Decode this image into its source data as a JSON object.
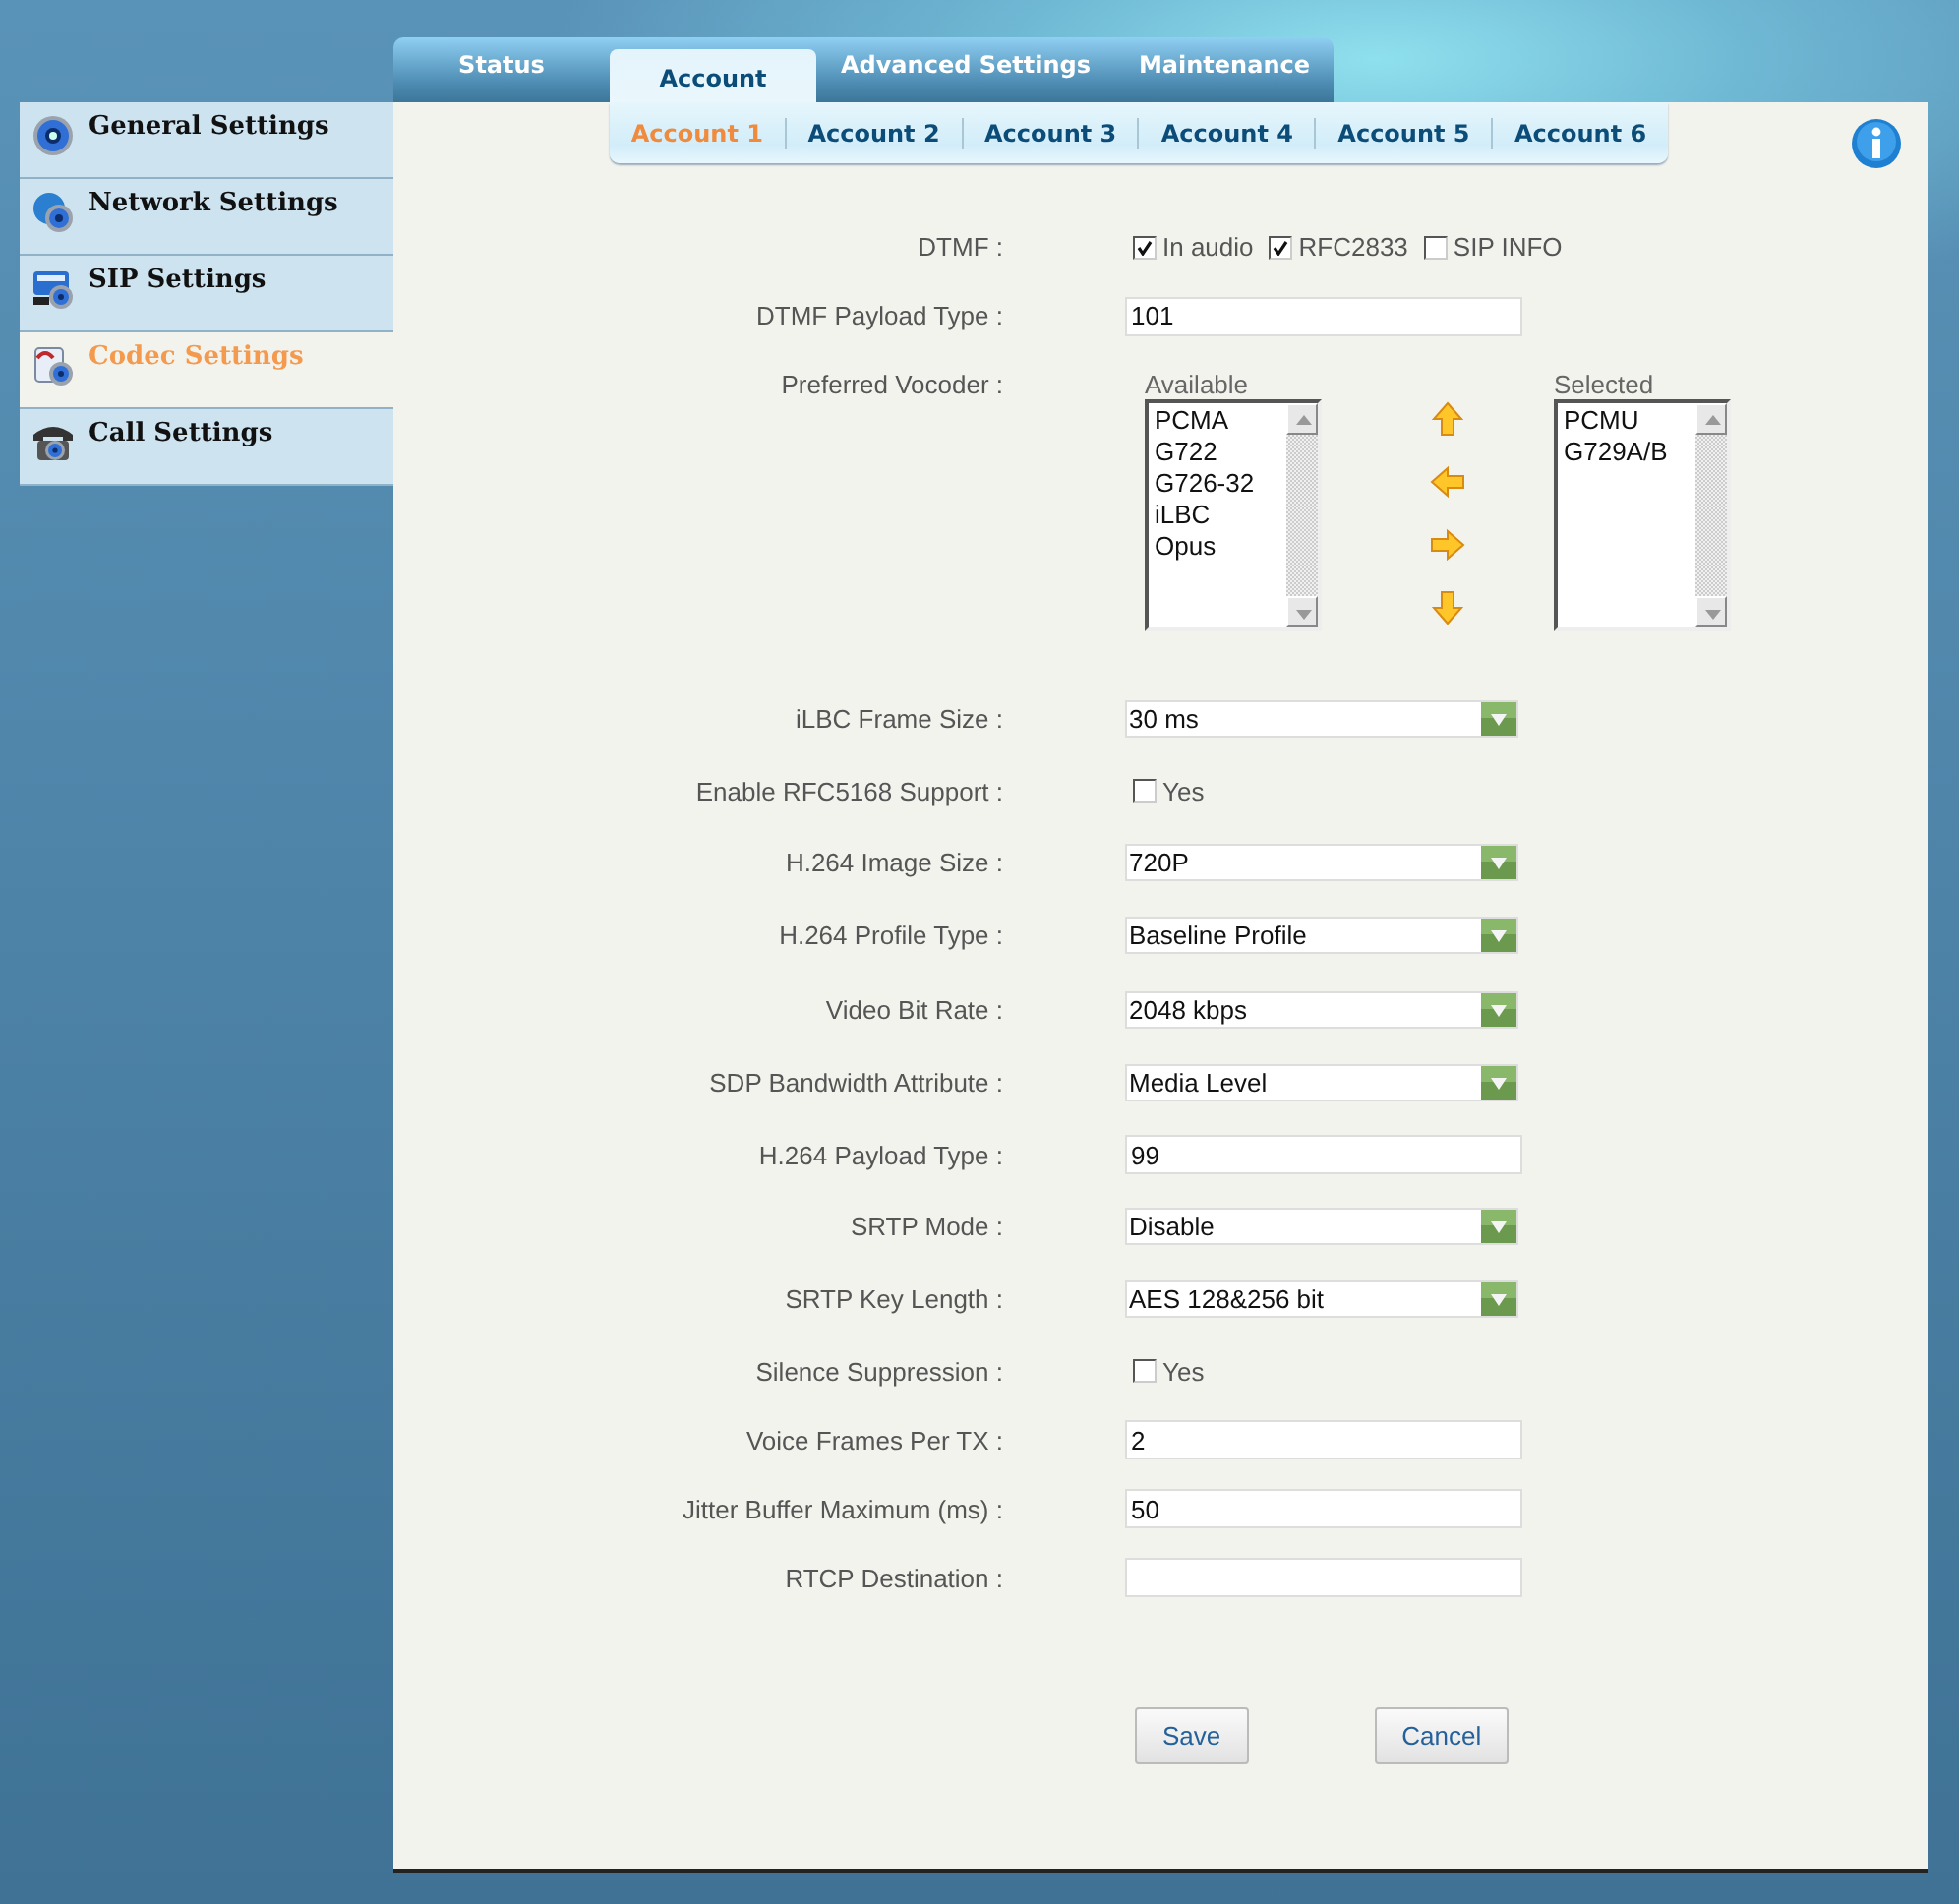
{
  "top_tabs": [
    {
      "label": "Status",
      "selected": false
    },
    {
      "label": "Account",
      "selected": true
    },
    {
      "label": "Advanced Settings",
      "selected": false
    },
    {
      "label": "Maintenance",
      "selected": false
    }
  ],
  "sidebar": {
    "items": [
      {
        "label": "General Settings",
        "selected": false
      },
      {
        "label": "Network Settings",
        "selected": false
      },
      {
        "label": "SIP Settings",
        "selected": false
      },
      {
        "label": "Codec Settings",
        "selected": true
      },
      {
        "label": "Call Settings",
        "selected": false
      }
    ]
  },
  "account_tabs": [
    {
      "label": "Account 1",
      "selected": true
    },
    {
      "label": "Account 2",
      "selected": false
    },
    {
      "label": "Account 3",
      "selected": false
    },
    {
      "label": "Account 4",
      "selected": false
    },
    {
      "label": "Account 5",
      "selected": false
    },
    {
      "label": "Account 6",
      "selected": false
    }
  ],
  "form": {
    "rows": [
      {
        "label": "DTMF :",
        "kind": "checks",
        "options": [
          {
            "label": "In audio",
            "checked": true
          },
          {
            "label": "RFC2833",
            "checked": true
          },
          {
            "label": "SIP INFO",
            "checked": false
          }
        ]
      },
      {
        "label": "DTMF Payload Type :",
        "kind": "text",
        "value": "101"
      },
      {
        "label": "Preferred Vocoder :",
        "kind": "vocoder",
        "available": {
          "heading": "Available",
          "items": [
            "PCMA",
            "G722",
            "G726-32",
            "iLBC",
            "Opus"
          ]
        },
        "chosen": {
          "heading": "Selected",
          "items": [
            "PCMU",
            "G729A/B"
          ]
        }
      },
      {
        "label": "iLBC Frame Size :",
        "kind": "select",
        "value": "30 ms"
      },
      {
        "label": "Enable RFC5168 Support :",
        "kind": "checks",
        "options": [
          {
            "label": "Yes",
            "checked": false
          }
        ]
      },
      {
        "label": "H.264 Image Size :",
        "kind": "select",
        "value": "720P"
      },
      {
        "label": "H.264 Profile Type :",
        "kind": "select",
        "value": "Baseline Profile"
      },
      {
        "label": "Video Bit Rate :",
        "kind": "select",
        "value": "2048 kbps"
      },
      {
        "label": "SDP Bandwidth Attribute :",
        "kind": "select",
        "value": "Media Level"
      },
      {
        "label": "H.264 Payload Type :",
        "kind": "text",
        "value": "99"
      },
      {
        "label": "SRTP Mode :",
        "kind": "select",
        "value": "Disable"
      },
      {
        "label": "SRTP Key Length :",
        "kind": "select",
        "value": "AES 128&256 bit"
      },
      {
        "label": "Silence Suppression :",
        "kind": "checks",
        "options": [
          {
            "label": "Yes",
            "checked": false
          }
        ]
      },
      {
        "label": "Voice Frames Per TX :",
        "kind": "text",
        "value": "2"
      },
      {
        "label": "Jitter Buffer Maximum (ms) :",
        "kind": "text",
        "value": "50"
      },
      {
        "label": "RTCP Destination :",
        "kind": "text"
      }
    ]
  },
  "buttons": [
    "Save",
    "Cancel"
  ]
}
